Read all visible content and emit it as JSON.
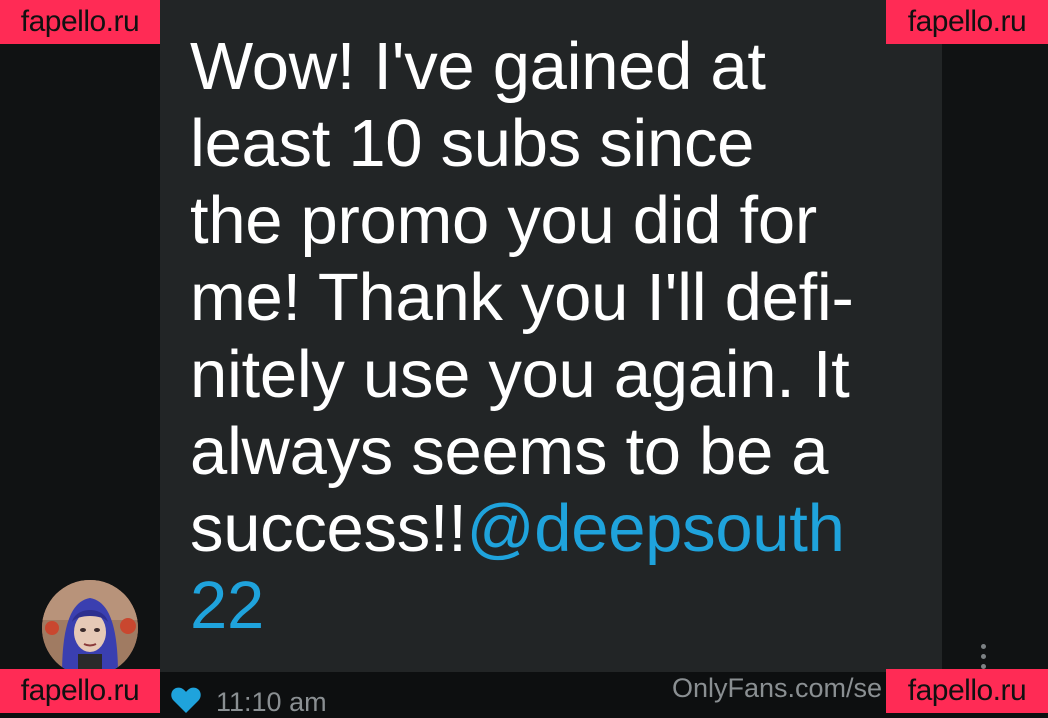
{
  "message": {
    "lines": [
      "Wow! I've gained at",
      "least 10 subs since",
      "the promo you did for",
      "me! Thank you I'll defi-",
      "nitely use you again. It",
      "always seems to be a"
    ],
    "last_line_text": "success!!",
    "mention_part1": "@deepsouth",
    "mention_part2": "22"
  },
  "footer": {
    "time": "11:10 am",
    "url": "OnlyFans.com/se"
  },
  "watermark": {
    "text": "fapello.ru"
  },
  "icons": {
    "like": "heart-icon",
    "more": "more-vertical-icon",
    "avatar": "profile-photo"
  },
  "colors": {
    "bubble_bg": "#222526",
    "mention": "#1fa3dc",
    "like_heart": "#1fa3dc",
    "watermark_bg": "#ff2b55"
  }
}
